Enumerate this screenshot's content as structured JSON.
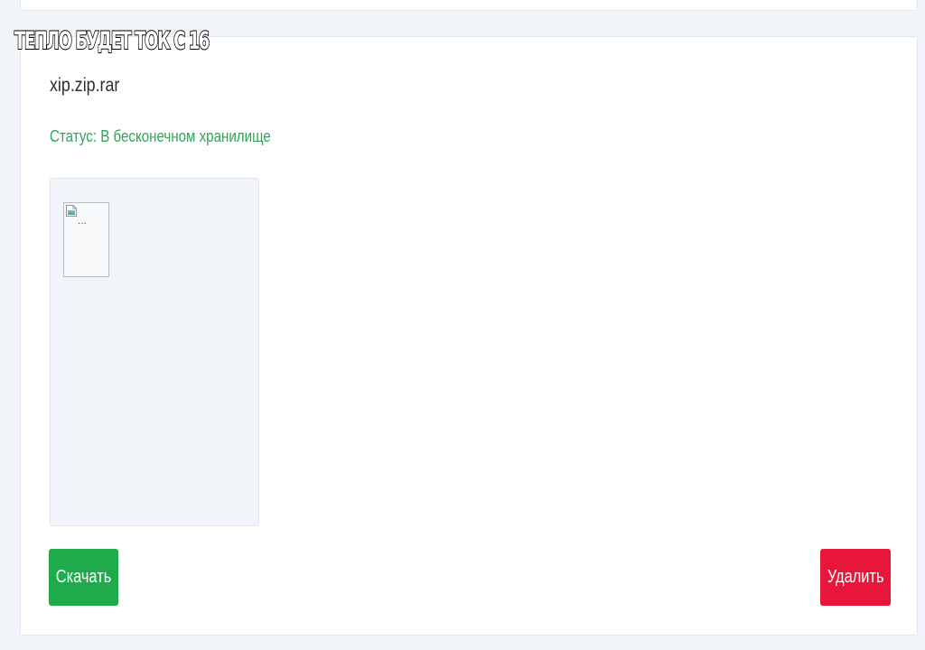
{
  "overlay_caption": "ТЕПЛО БУДЕТ ТОК С 16",
  "file": {
    "name": "xip.zip.rar",
    "status": "Статус: В бесконечном хранилище",
    "preview_alt": "..."
  },
  "actions": {
    "download_label": "Скачать",
    "delete_label": "Удалить"
  },
  "colors": {
    "status_green": "#2fa45a",
    "download_green": "#1faa4b",
    "delete_red": "#e8163a",
    "page_background": "#f1f4f8"
  },
  "icons": {
    "preview": "broken-image-icon"
  }
}
